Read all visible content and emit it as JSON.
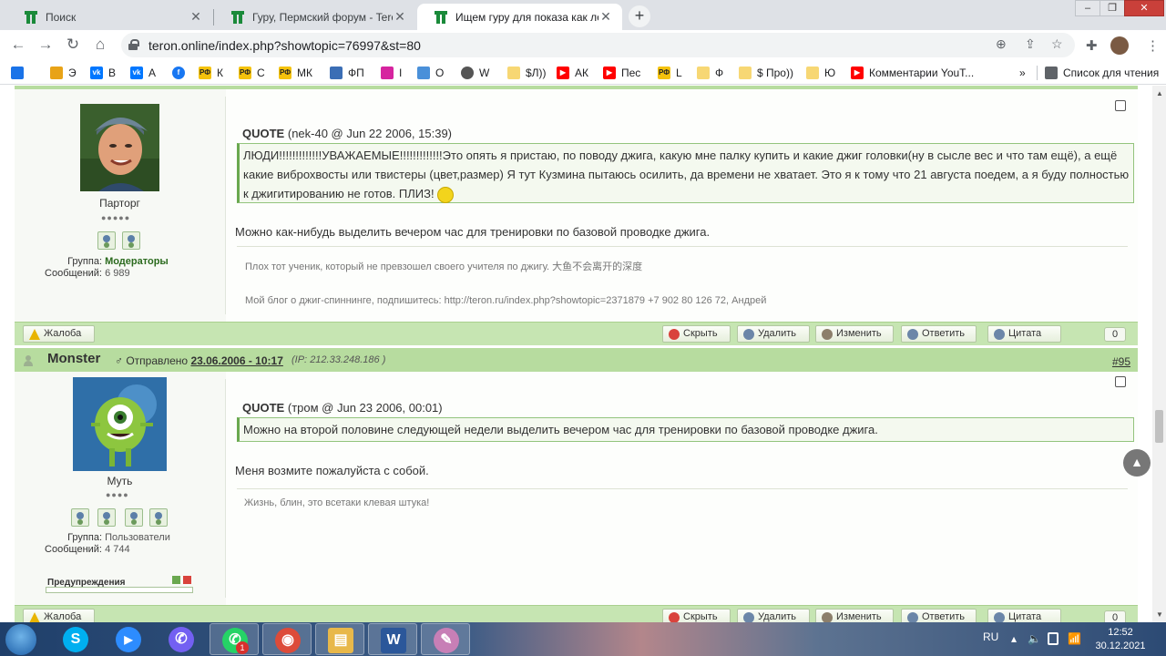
{
  "browser": {
    "tabs": [
      {
        "title": "Поиск",
        "active": false
      },
      {
        "title": "Гуру, Пермский форум - Teron.online",
        "active": false
      },
      {
        "title": "Ищем гуру для показа как ловят",
        "active": true
      }
    ],
    "close_glyph": "✕",
    "new_tab_glyph": "+",
    "window_controls": {
      "minimize": "–",
      "restore": "❐",
      "close": "✕"
    },
    "url": "teron.online/index.php?showtopic=76997&st=80",
    "nav": {
      "back": "←",
      "forward": "→",
      "reload": "↻",
      "home": "⌂"
    },
    "omni_icons": {
      "zoom": "⊕",
      "share": "⇪",
      "star": "☆"
    },
    "tool_icons": {
      "extensions": "✚",
      "menu": "⋮"
    },
    "bookmarks": [
      {
        "label": "",
        "icon": "mail-icon",
        "color": "#1a73e8"
      },
      {
        "label": "Э",
        "icon": "grid-icon",
        "color": "#e8a317"
      },
      {
        "label": "В",
        "icon": "vk-icon",
        "color": "#0077ff"
      },
      {
        "label": "А",
        "icon": "vk-icon",
        "color": "#0077ff"
      },
      {
        "label": "",
        "icon": "facebook-icon",
        "color": "#1877f2"
      },
      {
        "label": "К",
        "icon": "rf-icon",
        "color": "#f4c20d"
      },
      {
        "label": "С",
        "icon": "rf-icon",
        "color": "#f4c20d"
      },
      {
        "label": "МК",
        "icon": "rf-icon",
        "color": "#f4c20d"
      },
      {
        "label": "ФП",
        "icon": "chart-icon",
        "color": "#3b6eb5"
      },
      {
        "label": "I",
        "icon": "instagram-icon",
        "color": "#d6249f"
      },
      {
        "label": "О",
        "icon": "leaf-icon",
        "color": "#4a90d9"
      },
      {
        "label": "W",
        "icon": "globe-icon",
        "color": "#555555"
      },
      {
        "label": "$Л))",
        "icon": "folder-icon",
        "color": "#f7d774"
      },
      {
        "label": "АК",
        "icon": "youtube-icon",
        "color": "#ff0000"
      },
      {
        "label": "Пес",
        "icon": "youtube-icon",
        "color": "#ff0000"
      },
      {
        "label": "L",
        "icon": "rf-icon",
        "color": "#f4c20d"
      },
      {
        "label": "Ф",
        "icon": "folder-icon",
        "color": "#f7d774"
      },
      {
        "label": "$ Про))",
        "icon": "folder-icon",
        "color": "#f7d774"
      },
      {
        "label": "Ю",
        "icon": "folder-icon",
        "color": "#f7d774"
      },
      {
        "label": "Комментарии YouT...",
        "icon": "youtube-icon",
        "color": "#ff0000"
      }
    ],
    "more_glyph": "»",
    "reading_list": "Список для чтения",
    "scroll_glyphs": {
      "up": "▲",
      "down": "▼"
    }
  },
  "posts": [
    {
      "username_label": "Парторг",
      "pips": "●●●●●",
      "group_label": "Группа:",
      "group_value": "Модераторы",
      "messages_label": "Сообщений:",
      "messages_value": "6 989",
      "quote_label": "QUOTE",
      "quote_meta": "(nek-40 @ Jun 22 2006, 15:39)",
      "quote_text": "ЛЮДИ!!!!!!!!!!!!!УВАЖАЕМЫЕ!!!!!!!!!!!!!Это опять я пристаю, по поводу джига, какую мне палку купить и какие джиг головки(ну в сысле вес и что там ещё), а ещё какие виброхвосты или твистеры (цвет,размер) Я тут Кузмина пытаюсь осилить, да времени не хватает. Это я к тому что 21 августа  поедем, а я буду полностью к джигитированию не готов. ПЛИЗ!",
      "body": "Можно как-нибудь выделить вечером час для тренировки по базовой проводке джига.",
      "signature_1": "Плох тот ученик, который не превзошел своего учителя по джигу. 大鱼不会离开的深度",
      "signature_2": "Мой блог о джиг-спиннинге, подпишитесь: http://teron.ru/index.php?showtopic=2371879 +7 902 80 126 72, Андрей",
      "actions": {
        "report": "Жалоба",
        "hide": "Скрыть",
        "delete": "Удалить",
        "edit": "Изменить",
        "reply": "Ответить",
        "quote": "Цитата"
      },
      "count": "0"
    },
    {
      "author": "Monster",
      "sent_label": "Отправлено",
      "sent_date": "23.06.2006 - 10:17",
      "ip_label": "(IP:",
      "ip_value": "212.33.248.186",
      "ip_close": ")",
      "post_number": "#95",
      "username_label": "Муть",
      "pips": "●●●●",
      "group_label": "Группа:",
      "group_value": "Пользователи",
      "messages_label": "Сообщений:",
      "messages_value": "4 744",
      "warnings_label": "Предупреждения",
      "quote_label": "QUOTE",
      "quote_meta": "(тром @ Jun 23 2006, 00:01)",
      "quote_text": "Можно на второй половине следующей недели выделить вечером час для тренировки по базовой проводке джига.",
      "body": "Меня возмите пожалуйста с собой.",
      "signature_1": "Жизнь, блин, это всетаки клевая штука!",
      "actions": {
        "report": "Жалоба",
        "hide": "Скрыть",
        "delete": "Удалить",
        "edit": "Изменить",
        "reply": "Ответить",
        "quote": "Цитата"
      },
      "count": "0"
    }
  ],
  "scroll_top_glyph": "▲",
  "taskbar": {
    "apps": [
      {
        "name": "skype",
        "glyph": "S",
        "color": "#00aff0"
      },
      {
        "name": "zoom",
        "glyph": "▶",
        "color": "#2d8cff"
      },
      {
        "name": "viber",
        "glyph": "✆",
        "color": "#7360f2"
      },
      {
        "name": "whatsapp",
        "glyph": "✆",
        "color": "#25d366",
        "badge": "1"
      },
      {
        "name": "chrome",
        "glyph": "◉",
        "color": "#dd4b39"
      },
      {
        "name": "explorer",
        "glyph": "▤",
        "color": "#e8b84a"
      },
      {
        "name": "word",
        "glyph": "W",
        "color": "#2b579a"
      },
      {
        "name": "paint",
        "glyph": "✎",
        "color": "#c77fb6"
      }
    ],
    "lang": "RU",
    "tray_glyphs": {
      "expand": "▴",
      "volume": "🔈",
      "network": "📶"
    },
    "time": "12:52",
    "date": "30.12.2021"
  }
}
